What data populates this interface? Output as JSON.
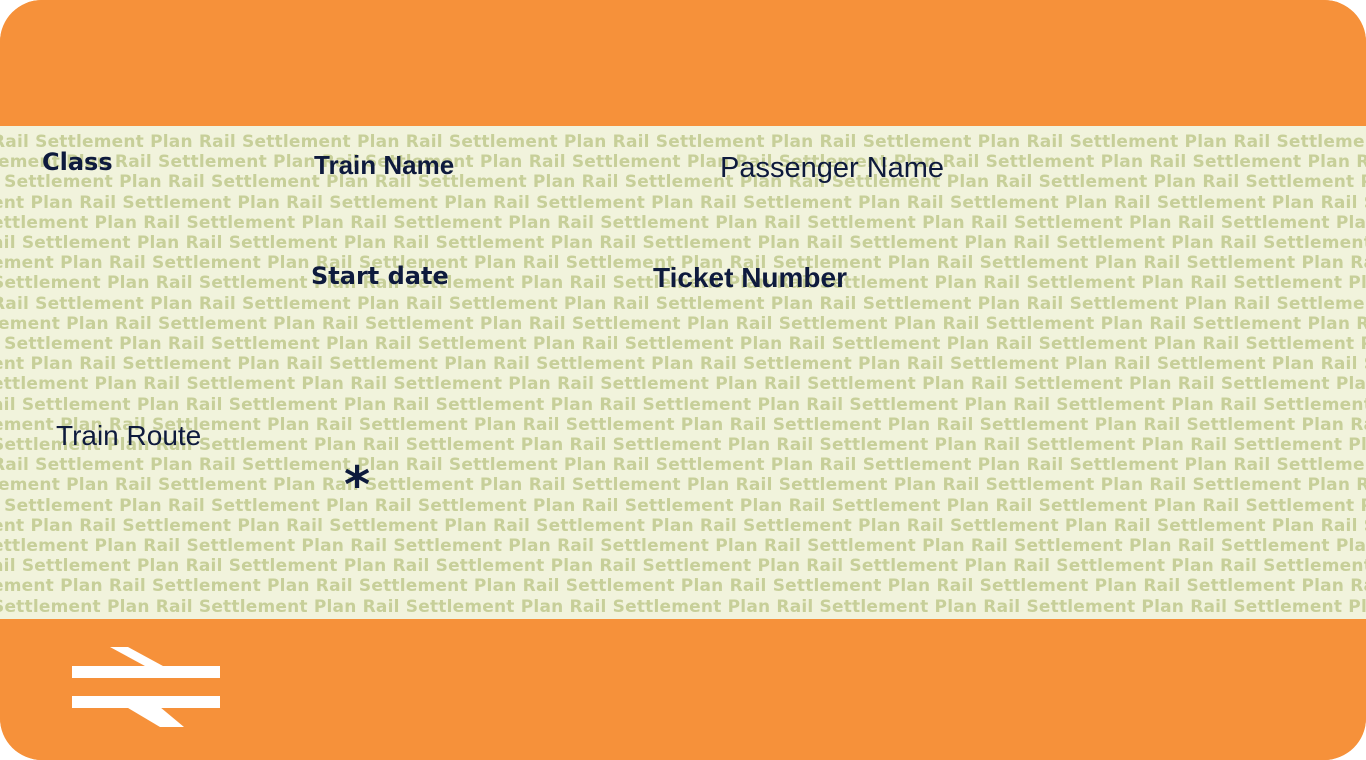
{
  "ticket": {
    "fields": {
      "class_label": "Class",
      "train_name_label": "Train Name",
      "passenger_name_label": "Passenger Name",
      "start_date_label": "Start date",
      "ticket_number_label": "Ticket  Number",
      "train_route_label": "Train Route",
      "marker": "*"
    },
    "background_pattern_text": "Rail Settlement Plan",
    "logo": "double-arrow-rail-logo",
    "colors": {
      "orange": "#f6913a",
      "pattern_bg": "#f1f3dc",
      "pattern_text": "#c7cf99",
      "label_text": "#0e1a3d"
    }
  }
}
